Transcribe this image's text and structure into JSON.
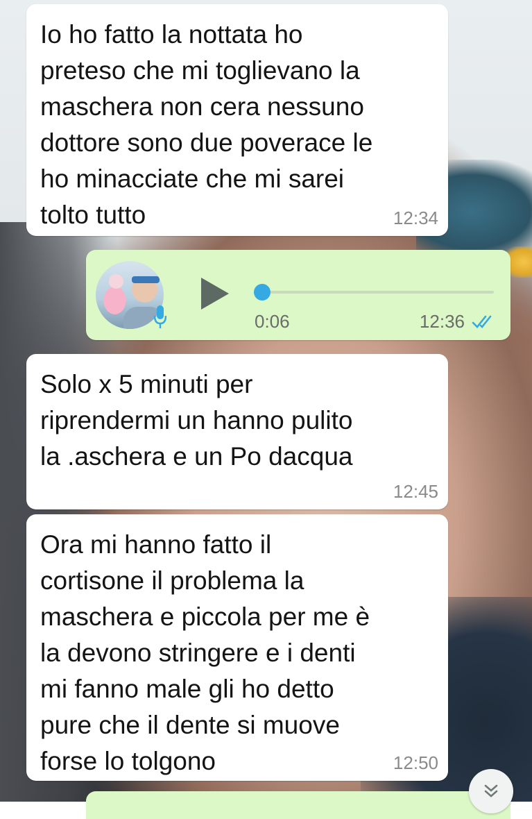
{
  "messages": [
    {
      "type": "incoming",
      "text": "Io ho fatto la nottata ho\npreteso che mi toglievano la\nmaschera non cera nessuno\ndottore sono due poverace le\nho minacciate che mi sarei\ntolto tutto",
      "time": "12:34"
    },
    {
      "type": "outgoing-voice",
      "duration": "0:06",
      "time": "12:36",
      "progress": 0,
      "status_icon": "double-check-read-icon"
    },
    {
      "type": "incoming",
      "text": "Solo x 5 minuti per\nriprendermi un hanno pulito\nla .aschera e un Po dacqua",
      "time": "12:45"
    },
    {
      "type": "incoming",
      "text": "Ora mi hanno fatto il\ncortisone il problema la\nmaschera e piccola per me è\nla devono stringere e i denti\nmi fanno male gli ho detto\npure che il dente si muove\nforse lo tolgono",
      "time": "12:50"
    }
  ],
  "colors": {
    "incoming_bubble": "#ffffff",
    "outgoing_bubble": "#dcf8c6",
    "read_ticks": "#34a9e2",
    "play_icon": "#5d6a63"
  },
  "icons": {
    "play": "play-icon",
    "mic": "microphone-icon",
    "scroll": "scroll-down-chevron-icon"
  }
}
